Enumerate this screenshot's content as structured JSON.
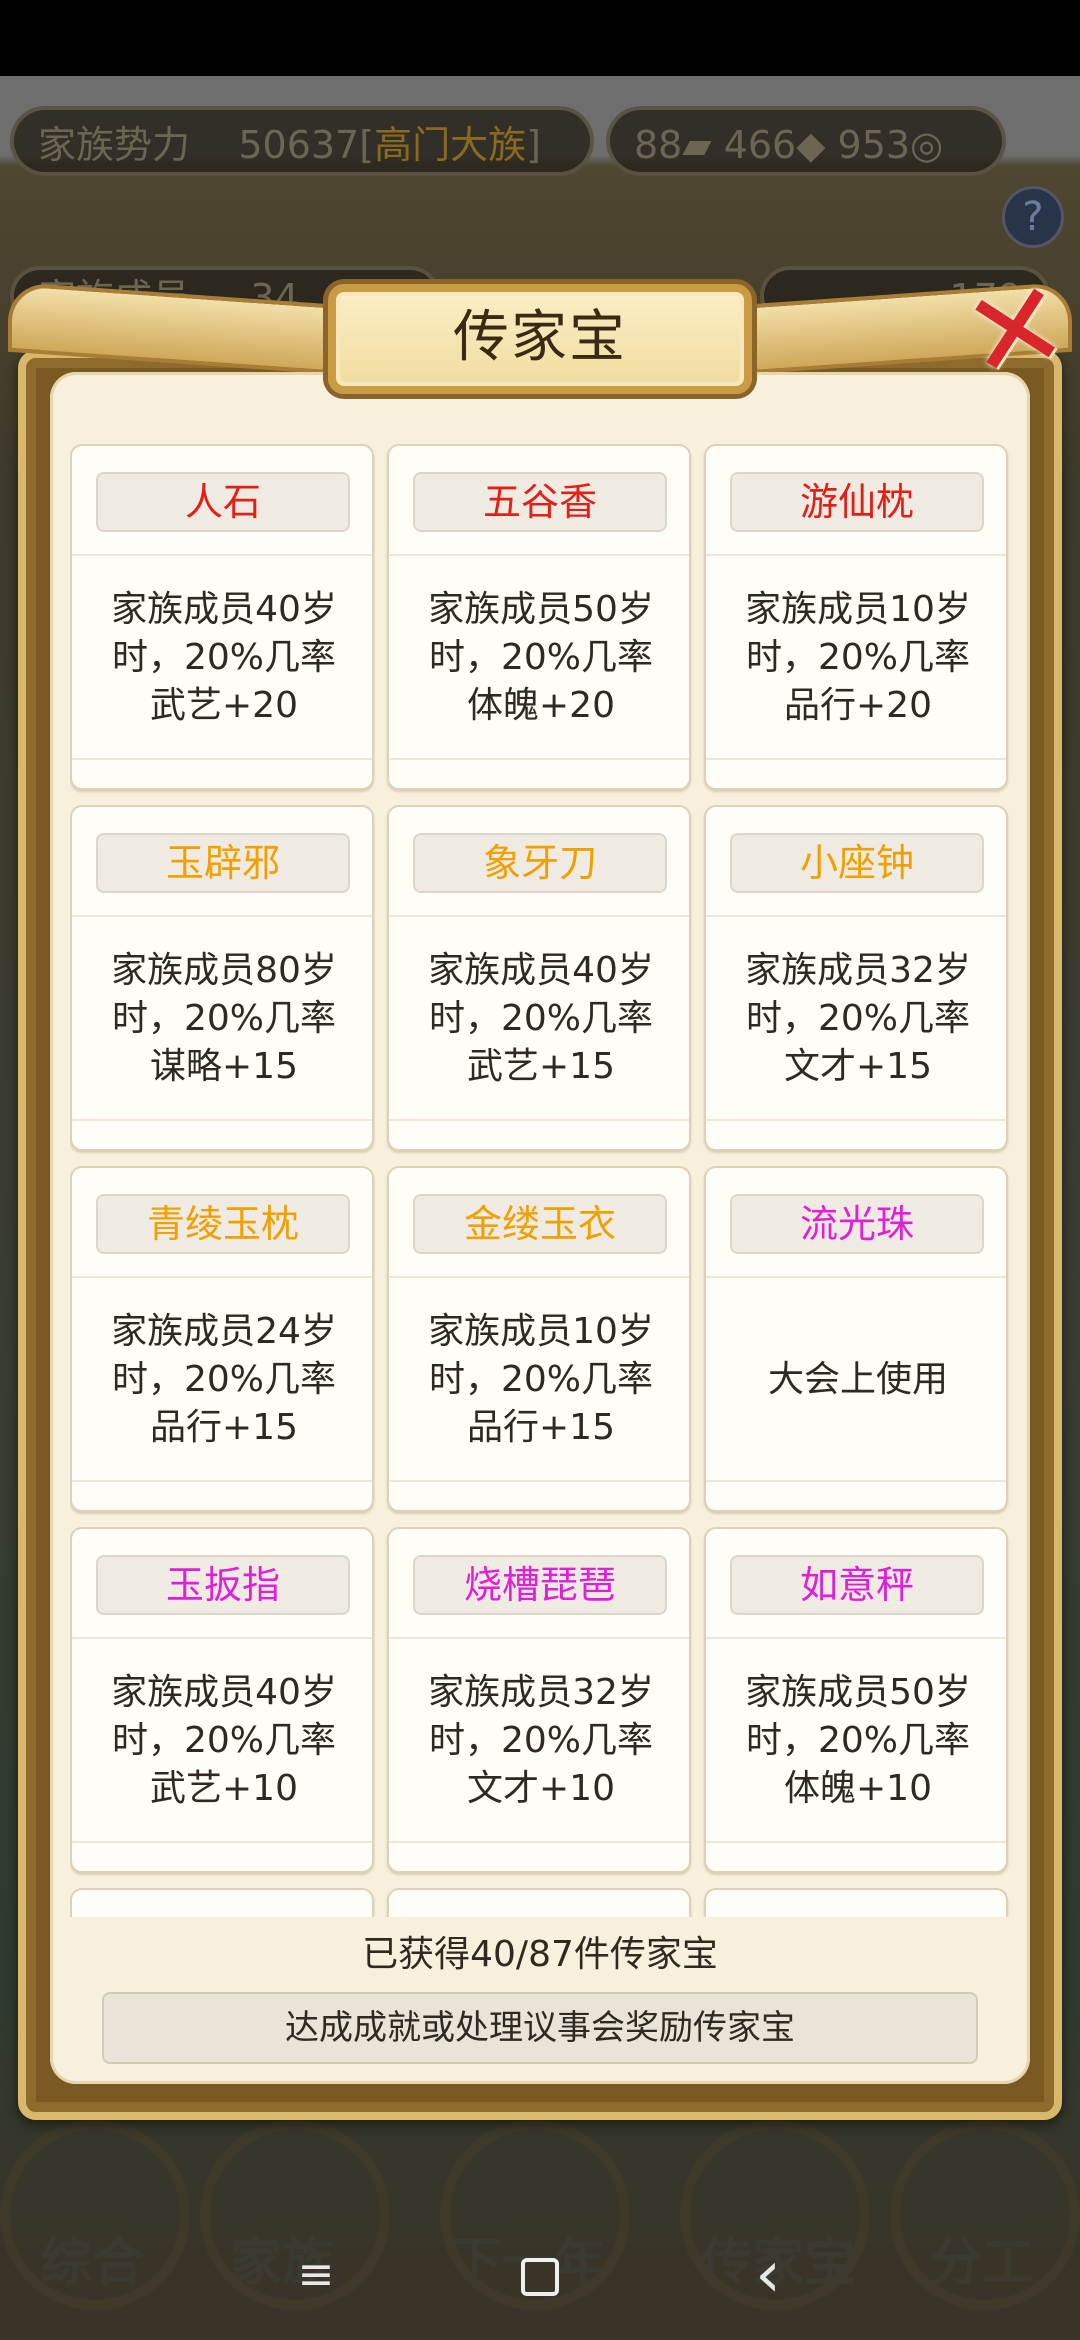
{
  "background": {
    "family_power_label": "家族势力",
    "family_power_value": "50637",
    "family_rank": "高门大族",
    "family_members_label": "家族成员",
    "family_members_value": "34",
    "resource_1": "88",
    "resource_2": "466",
    "resource_3": "953",
    "resource_4": "179",
    "help_label": "?",
    "nav": [
      "综合",
      "家族",
      "下一年",
      "传家宝",
      "分工"
    ]
  },
  "modal": {
    "title": "传家宝",
    "close_label": "✕",
    "items": [
      {
        "name": "人石",
        "rarity": "red",
        "desc": "家族成员40岁时，20%几率武艺+20"
      },
      {
        "name": "五谷香",
        "rarity": "red",
        "desc": "家族成员50岁时，20%几率体魄+20"
      },
      {
        "name": "游仙枕",
        "rarity": "red",
        "desc": "家族成员10岁时，20%几率品行+20"
      },
      {
        "name": "玉辟邪",
        "rarity": "orange",
        "desc": "家族成员80岁时，20%几率谋略+15"
      },
      {
        "name": "象牙刀",
        "rarity": "orange",
        "desc": "家族成员40岁时，20%几率武艺+15"
      },
      {
        "name": "小座钟",
        "rarity": "orange",
        "desc": "家族成员32岁时，20%几率文才+15"
      },
      {
        "name": "青绫玉枕",
        "rarity": "orange",
        "desc": "家族成员24岁时，20%几率品行+15"
      },
      {
        "name": "金缕玉衣",
        "rarity": "orange",
        "desc": "家族成员10岁时，20%几率品行+15"
      },
      {
        "name": "流光珠",
        "rarity": "purple",
        "desc": "大会上使用"
      },
      {
        "name": "玉扳指",
        "rarity": "purple",
        "desc": "家族成员40岁时，20%几率武艺+10"
      },
      {
        "name": "烧槽琵琶",
        "rarity": "purple",
        "desc": "家族成员32岁时，20%几率文才+10"
      },
      {
        "name": "如意秤",
        "rarity": "purple",
        "desc": "家族成员50岁时，20%几率体魄+10"
      }
    ],
    "count_text": "已获得40/87件传家宝",
    "hint_text": "达成成就或处理议事会奖励传家宝"
  },
  "colors": {
    "red": "#e22018",
    "orange": "#f0a000",
    "purple": "#e020d8"
  },
  "system_nav": {
    "menu_icon": "≡",
    "home_icon": "square-home-icon",
    "back_icon": "‹"
  }
}
